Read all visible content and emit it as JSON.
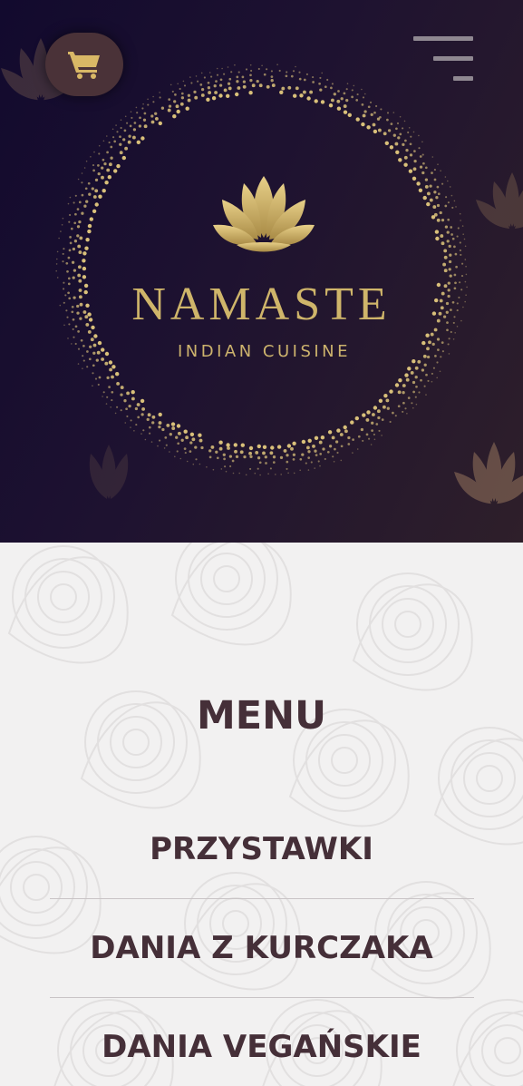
{
  "hero": {
    "brand_name": "NAMASTE",
    "brand_tagline": "INDIAN CUISINE",
    "cart_icon": "shopping-cart-icon",
    "menu_icon": "hamburger-menu-icon",
    "logo_icon": "lotus-icon"
  },
  "menu": {
    "heading": "MENU",
    "categories": [
      {
        "label": "PRZYSTAWKI"
      },
      {
        "label": "DANIA Z KURCZAKA"
      },
      {
        "label": "DANIA VEGAŃSKIE"
      }
    ]
  },
  "colors": {
    "hero_dark": "#120a2e",
    "gold": "#cfb56a",
    "text_dark": "#452f38",
    "cart_bg": "#4a3238"
  }
}
